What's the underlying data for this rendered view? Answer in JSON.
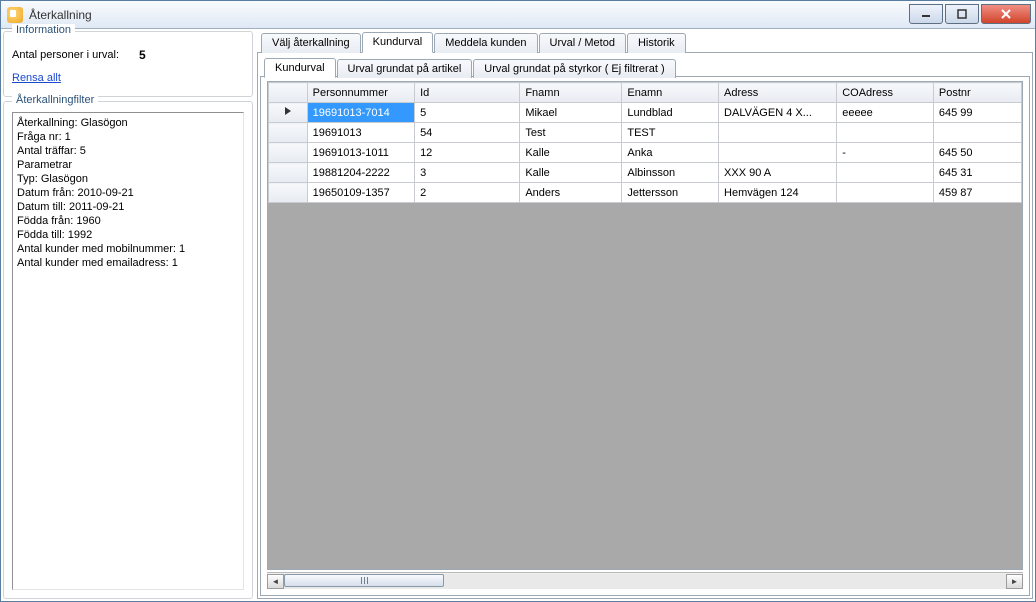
{
  "window": {
    "title": "Återkallning"
  },
  "info_panel": {
    "legend": "Information",
    "count_label": "Antal personer i urval:",
    "count_value": "5",
    "clear_link": "Rensa allt"
  },
  "filter_panel": {
    "legend": "Återkallningfilter",
    "lines": [
      "Återkallning: Glasögon",
      "Fråga nr: 1",
      "Antal träffar: 5",
      "Parametrar",
      "Typ: Glasögon",
      "Datum från: 2010-09-21",
      "Datum till: 2011-09-21",
      "Födda från: 1960",
      "Födda till: 1992",
      "Antal kunder med mobilnummer: 1",
      "Antal kunder med emailadress: 1"
    ]
  },
  "main_tabs": [
    "Välj återkallning",
    "Kundurval",
    "Meddela kunden",
    "Urval / Metod",
    "Historik"
  ],
  "main_tab_active": 1,
  "sub_tabs": [
    "Kundurval",
    "Urval grundat på artikel",
    "Urval grundat på styrkor ( Ej filtrerat )"
  ],
  "sub_tab_active": 0,
  "grid": {
    "columns": [
      "Personnummer",
      "Id",
      "Fnamn",
      "Enamn",
      "Adress",
      "COAdress",
      "Postnr"
    ],
    "rows": [
      {
        "selected": true,
        "cells": [
          "19691013-7014",
          "5",
          "Mikael",
          "Lundblad",
          "DALVÄGEN 4 X...",
          "eeeee",
          "645 99"
        ]
      },
      {
        "selected": false,
        "cells": [
          "19691013",
          "54",
          "Test",
          "TEST",
          "",
          "",
          ""
        ]
      },
      {
        "selected": false,
        "cells": [
          "19691013-1011",
          "12",
          "Kalle",
          "Anka",
          "",
          "-",
          "645 50"
        ]
      },
      {
        "selected": false,
        "cells": [
          "19881204-2222",
          "3",
          "Kalle",
          "Albinsson",
          "XXX 90 A",
          "",
          "645 31"
        ]
      },
      {
        "selected": false,
        "cells": [
          "19650109-1357",
          "2",
          "Anders",
          "Jettersson",
          "Hemvägen 124",
          "",
          "459 87"
        ]
      }
    ]
  }
}
